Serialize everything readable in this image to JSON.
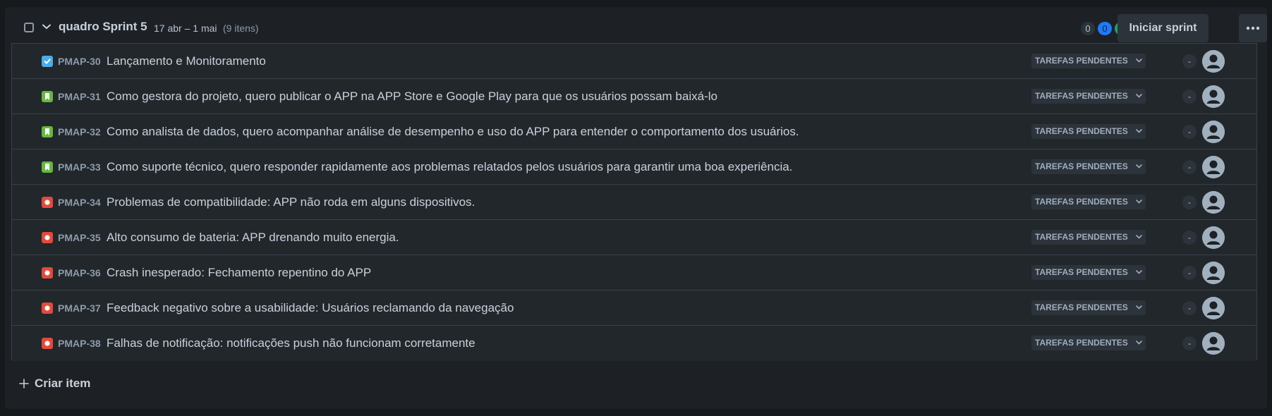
{
  "sprint": {
    "name": "quadro Sprint 5",
    "dates": "17 abr – 1 mai",
    "item_count": "(9 itens)",
    "counts": {
      "todo": "0",
      "in_progress": "0",
      "done": "0"
    },
    "start_label": "Iniciar sprint",
    "more_icon": "more-horizontal-icon"
  },
  "issues": [
    {
      "type": "task",
      "key": "PMAP-30",
      "summary": "Lançamento e Monitoramento",
      "status": "TAREFAS PENDENTES",
      "estimate": "-"
    },
    {
      "type": "story",
      "key": "PMAP-31",
      "summary": "Como gestora do projeto, quero publicar o APP na APP Store e Google Play para que os usuários possam baixá-lo",
      "status": "TAREFAS PENDENTES",
      "estimate": "-"
    },
    {
      "type": "story",
      "key": "PMAP-32",
      "summary": "Como analista de dados, quero acompanhar análise de desempenho e uso do APP para entender o comportamento dos usuários.",
      "status": "TAREFAS PENDENTES",
      "estimate": "-"
    },
    {
      "type": "story",
      "key": "PMAP-33",
      "summary": "Como suporte técnico, quero responder rapidamente aos problemas relatados pelos usuários para garantir uma boa experiência.",
      "status": "TAREFAS PENDENTES",
      "estimate": "-"
    },
    {
      "type": "bug",
      "key": "PMAP-34",
      "summary": "Problemas de compatibilidade: APP não roda em alguns dispositivos.",
      "status": "TAREFAS PENDENTES",
      "estimate": "-"
    },
    {
      "type": "bug",
      "key": "PMAP-35",
      "summary": "Alto consumo de bateria: APP drenando muito energia.",
      "status": "TAREFAS PENDENTES",
      "estimate": "-"
    },
    {
      "type": "bug",
      "key": "PMAP-36",
      "summary": "Crash inesperado: Fechamento repentino do APP",
      "status": "TAREFAS PENDENTES",
      "estimate": "-"
    },
    {
      "type": "bug",
      "key": "PMAP-37",
      "summary": "Feedback negativo sobre a usabilidade: Usuários reclamando da navegação",
      "status": "TAREFAS PENDENTES",
      "estimate": "-"
    },
    {
      "type": "bug",
      "key": "PMAP-38",
      "summary": "Falhas de notificação: notificações push não funcionam corretamente",
      "status": "TAREFAS PENDENTES",
      "estimate": "-"
    }
  ],
  "create_label": "Criar item",
  "colors": {
    "task": "#4bade8",
    "story": "#63ba3c",
    "bug": "#e5493a",
    "in_progress": "#1d7afc",
    "done": "#22a06b"
  }
}
